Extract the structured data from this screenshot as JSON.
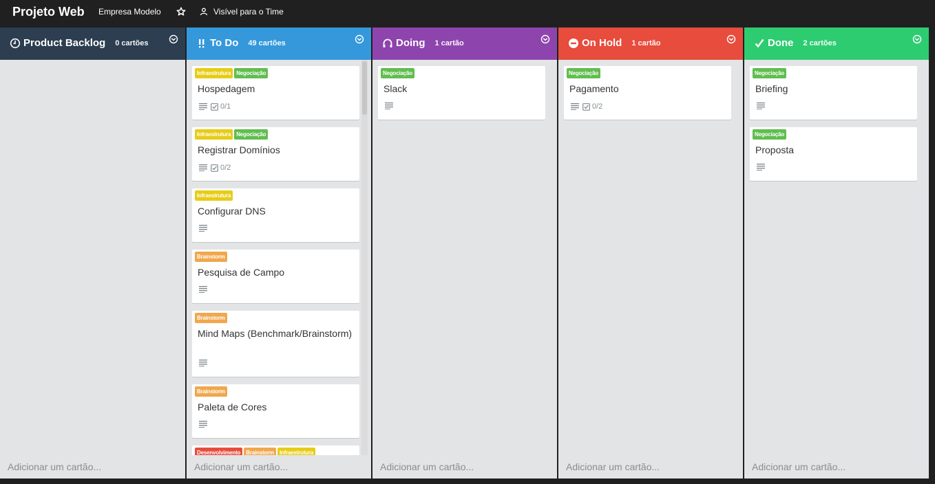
{
  "topbar": {
    "title": "Projeto Web",
    "org": "Empresa Modelo",
    "visibility": "Visível para o Time"
  },
  "colors": {
    "backlog": "#2c3e50",
    "todo": "#3498db",
    "doing": "#8e44ad",
    "onhold": "#e74c3c",
    "done": "#2ecc71",
    "label_infra": "#e7cc17",
    "label_neg": "#61bd4f",
    "label_brain": "#f0a74d",
    "label_dev": "#e74c3c"
  },
  "lists": [
    {
      "name": "Product Backlog",
      "count": "0 cartões",
      "icon": "clock-icon",
      "add": "Adicionar um cartão...",
      "cards": []
    },
    {
      "name": "To Do",
      "count": "49 cartões",
      "icon": "double-exclamation-icon",
      "add": "Adicionar um cartão...",
      "cards": [
        {
          "labels": [
            "Infraestrutura",
            "Negociação"
          ],
          "title": "Hospedagem",
          "check": "0/1"
        },
        {
          "labels": [
            "Infraestrutura",
            "Negociação"
          ],
          "title": "Registrar Domínios",
          "check": "0/2"
        },
        {
          "labels": [
            "Infraestrutura"
          ],
          "title": "Configurar DNS"
        },
        {
          "labels": [
            "Brainstorm"
          ],
          "title": "Pesquisa de Campo"
        },
        {
          "labels": [
            "Brainstorm"
          ],
          "title": "Mind Maps (Benchmark/Brainstorm)"
        },
        {
          "labels": [
            "Brainstorm"
          ],
          "title": "Paleta de Cores"
        },
        {
          "labels": [
            "Desenvolvimento",
            "Brainstorm",
            "Infraestrutura"
          ],
          "title": ""
        }
      ]
    },
    {
      "name": "Doing",
      "count": "1 cartão",
      "icon": "headset-icon",
      "add": "Adicionar um cartão...",
      "cards": [
        {
          "labels": [
            "Negociação"
          ],
          "title": "Slack"
        }
      ]
    },
    {
      "name": "On Hold",
      "count": "1 cartão",
      "icon": "stop-icon",
      "add": "Adicionar um cartão...",
      "cards": [
        {
          "labels": [
            "Negociação"
          ],
          "title": "Pagamento",
          "check": "0/2"
        }
      ]
    },
    {
      "name": "Done",
      "count": "2 cartões",
      "icon": "checkmark-icon",
      "add": "Adicionar um cartão...",
      "cards": [
        {
          "labels": [
            "Negociação"
          ],
          "title": "Briefing"
        },
        {
          "labels": [
            "Negociação"
          ],
          "title": "Proposta"
        }
      ]
    }
  ]
}
